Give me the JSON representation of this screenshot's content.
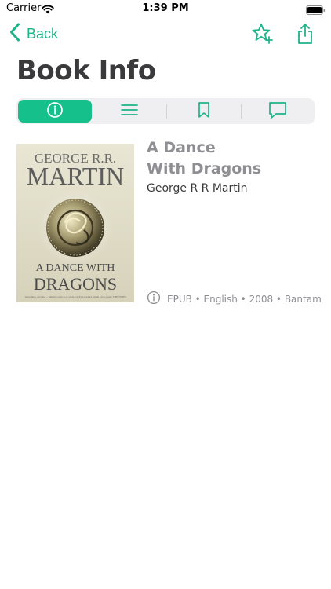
{
  "status_bar": {
    "carrier": "Carrier",
    "time": "1:39 PM"
  },
  "nav": {
    "back_label": "Back",
    "icons": [
      "chevron-left-icon",
      "star-add-icon",
      "share-icon"
    ]
  },
  "page": {
    "title": "Book Info"
  },
  "tabs": [
    {
      "icon": "info-icon",
      "active": true
    },
    {
      "icon": "list-icon",
      "active": false
    },
    {
      "icon": "bookmark-icon",
      "active": false
    },
    {
      "icon": "comment-icon",
      "active": false
    }
  ],
  "book": {
    "title_line1": "A Dance",
    "title_line2": "With Dragons",
    "author": "George R R Martin",
    "meta": "EPUB • English • 2008 • Bantam",
    "cover": {
      "author_line1": "GEORGE R.R.",
      "author_line2": "MARTIN",
      "title_line1": "A DANCE WITH",
      "title_line2": "DRAGONS",
      "tagline": "'Absorbing, exciting ... Martin's style is so vivid you'll be hooked within a few pages' THE TIMES"
    }
  },
  "colors": {
    "accent": "#1fb389",
    "active_tab": "#15c08b",
    "title": "#3a3a3c",
    "muted": "#8e8e93"
  }
}
